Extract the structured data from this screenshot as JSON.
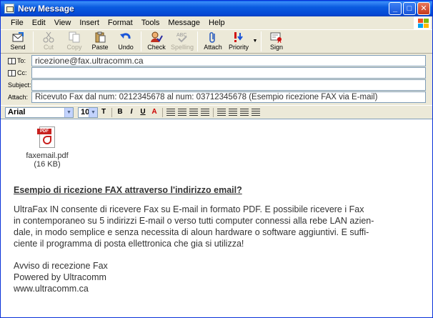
{
  "window": {
    "title": "New Message"
  },
  "menu": [
    "File",
    "Edit",
    "View",
    "Insert",
    "Format",
    "Tools",
    "Message",
    "Help"
  ],
  "toolbar": {
    "send": "Send",
    "cut": "Cut",
    "copy": "Copy",
    "paste": "Paste",
    "undo": "Undo",
    "check": "Check",
    "spelling": "Spelling",
    "attach": "Attach",
    "priority": "Priority",
    "sign": "Sign"
  },
  "fields": {
    "to_label": "To:",
    "to_value": "ricezione@fax.ultracomm.ca",
    "cc_label": "Cc:",
    "cc_value": "",
    "subject_label": "Subject:",
    "subject_value": "",
    "attach_label": "Attach:",
    "attach_value": "Ricevuto Fax dal num: 0212345678 al num: 03712345678 (Esempio ricezione FAX via E-mail)"
  },
  "format": {
    "font": "Arial",
    "size": "10"
  },
  "colors": {
    "titlebar": "#0548d4",
    "accent": "#c8201e"
  },
  "attachment": {
    "name": "faxemail.pdf",
    "size": "(16 KB)",
    "icon": "pdf-icon",
    "badge": "PDF"
  },
  "message": {
    "heading": "Esempio di ricezione FAX attraverso l'indirizzo email?",
    "paragraph": [
      "UltraFax IN consente di ricevere Fax su E-mail in formato PDF. E possibile ricevere i Fax",
      "in contemporaneo su 5 indirizzi E-mail o verso tutti computer connessi alla rebe LAN azien-",
      "dale, in modo semplice e senza necessita di aloun hardware o software aggiuntivi. E suffi-",
      "ciente il programma di posta ellettronica che gia si utilizza!"
    ],
    "signature": [
      "Avviso di recezione Fax",
      "Powered by Ultracomm",
      "www.ultracomm.ca"
    ]
  }
}
